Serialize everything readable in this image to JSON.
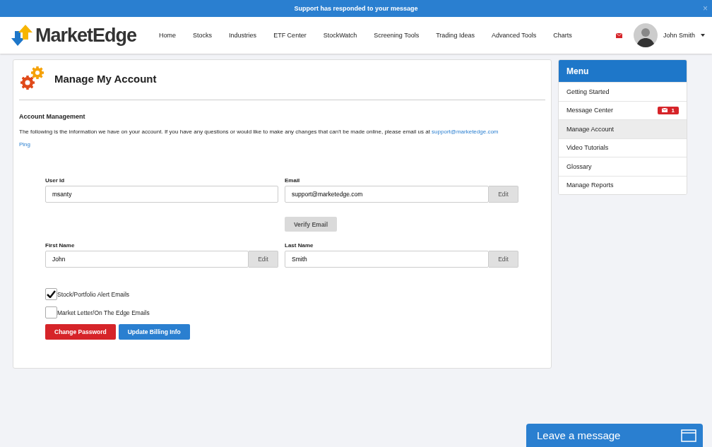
{
  "banner": {
    "text": "Support has responded to your message",
    "close": "×"
  },
  "header": {
    "logo": "MarketEdge",
    "nav": [
      {
        "label": "Home"
      },
      {
        "label": "Stocks"
      },
      {
        "label": "Industries"
      },
      {
        "label": "ETF Center"
      },
      {
        "label": "StockWatch"
      },
      {
        "label": "Screening Tools"
      },
      {
        "label": "Trading Ideas"
      },
      {
        "label": "Advanced Tools"
      },
      {
        "label": "Charts"
      }
    ],
    "user": "John Smith"
  },
  "page": {
    "title": "Manage My Account",
    "section": "Account Management",
    "intro": "The following is the information we have on your account. If you have any questions or would like to make any changes that can't be made online, please email us at",
    "email_link": "support@marketedge.com",
    "ping": "Ping",
    "field_rows": [
      [
        {
          "label": "User Id",
          "value": "msanty"
        },
        {
          "label": "Email",
          "value": "support@marketedge.com",
          "edit": "Edit"
        }
      ],
      [
        {
          "label": "First Name",
          "value": "John",
          "edit": "Edit"
        },
        {
          "label": "Last Name",
          "value": "Smith",
          "edit": "Edit"
        }
      ]
    ],
    "verify_button": "Verify Email",
    "checkboxes": [
      {
        "label": "Stock/Portfolio Alert Emails",
        "checked": true
      },
      {
        "label": "Market Letter/On The Edge Emails",
        "checked": false
      }
    ],
    "buttons": [
      {
        "label": "Change Password",
        "kind": "danger"
      },
      {
        "label": "Update Billing Info",
        "kind": "primary"
      }
    ]
  },
  "menu": {
    "title": "Menu",
    "items": [
      {
        "label": "Getting Started",
        "selected": false
      },
      {
        "label": "Message Center",
        "selected": false,
        "badge": "1"
      },
      {
        "label": "Manage Account",
        "selected": true
      },
      {
        "label": "Video Tutorials",
        "selected": false
      },
      {
        "label": "Glossary",
        "selected": false
      },
      {
        "label": "Manage Reports",
        "selected": false
      }
    ]
  },
  "chat": {
    "label": "Leave a message"
  }
}
